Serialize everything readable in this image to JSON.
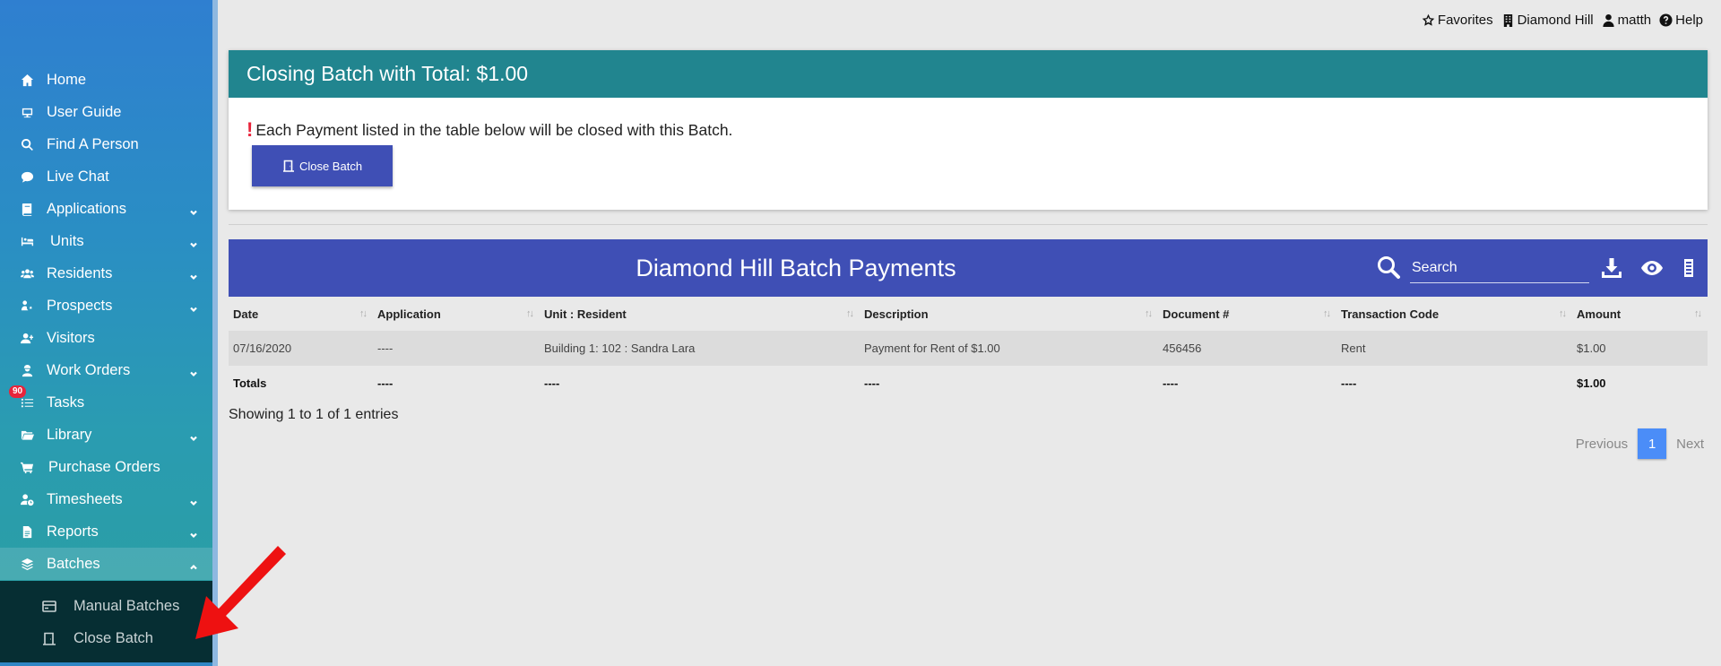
{
  "sidebar": {
    "items": [
      {
        "label": "Home",
        "icon": "home-icon",
        "has_chevron": false
      },
      {
        "label": "User Guide",
        "icon": "guide-icon",
        "has_chevron": false
      },
      {
        "label": "Find A Person",
        "icon": "search-icon",
        "has_chevron": false
      },
      {
        "label": "Live Chat",
        "icon": "chat-icon",
        "has_chevron": false
      },
      {
        "label": "Applications",
        "icon": "book-icon",
        "has_chevron": true
      },
      {
        "label": "Units",
        "icon": "bed-icon",
        "has_chevron": true
      },
      {
        "label": "Residents",
        "icon": "users-icon",
        "has_chevron": true
      },
      {
        "label": "Prospects",
        "icon": "gear-icon",
        "has_chevron": true
      },
      {
        "label": "Visitors",
        "icon": "user-plus-icon",
        "has_chevron": false
      },
      {
        "label": "Work Orders",
        "icon": "worker-icon",
        "has_chevron": true
      },
      {
        "label": "Tasks",
        "icon": "tasks-icon",
        "has_chevron": false,
        "badge": "90"
      },
      {
        "label": "Library",
        "icon": "folder-icon",
        "has_chevron": true
      },
      {
        "label": "Purchase Orders",
        "icon": "cart-icon",
        "has_chevron": false
      },
      {
        "label": "Timesheets",
        "icon": "user-clock-icon",
        "has_chevron": true
      },
      {
        "label": "Reports",
        "icon": "file-icon",
        "has_chevron": true
      },
      {
        "label": "Batches",
        "icon": "layers-icon",
        "has_chevron": true,
        "expanded": true
      }
    ],
    "submenu": [
      {
        "label": "Manual Batches",
        "icon": "card-icon"
      },
      {
        "label": "Close Batch",
        "icon": "door-icon"
      }
    ]
  },
  "topbar": {
    "favorites": "Favorites",
    "property": "Diamond Hill",
    "user": "matth",
    "help": "Help"
  },
  "close_panel": {
    "title": "Closing Batch with Total: $1.00",
    "notice_mark": "!",
    "notice": "Each Payment listed in the table below will be closed with this Batch.",
    "button_label": "Close Batch"
  },
  "table_panel": {
    "title": "Diamond Hill Batch Payments",
    "search_placeholder": "Search",
    "columns": [
      "Date",
      "Application",
      "Unit : Resident",
      "Description",
      "Document #",
      "Transaction Code",
      "Amount"
    ],
    "rows": [
      [
        "07/16/2020",
        "----",
        "Building 1: 102 : Sandra Lara",
        "Payment for Rent of $1.00",
        "456456",
        "Rent",
        "$1.00"
      ]
    ],
    "totals": [
      "Totals",
      "----",
      "----",
      "----",
      "----",
      "----",
      "$1.00"
    ],
    "showing": "Showing 1 to 1 of 1 entries",
    "pager": {
      "previous": "Previous",
      "current": "1",
      "next": "Next"
    }
  },
  "colors": {
    "panel_header": "#21858f",
    "table_header": "#3f4fb5",
    "button": "#3f4fb5",
    "badge": "#e8243b",
    "annotation_arrow": "#ee1111"
  }
}
